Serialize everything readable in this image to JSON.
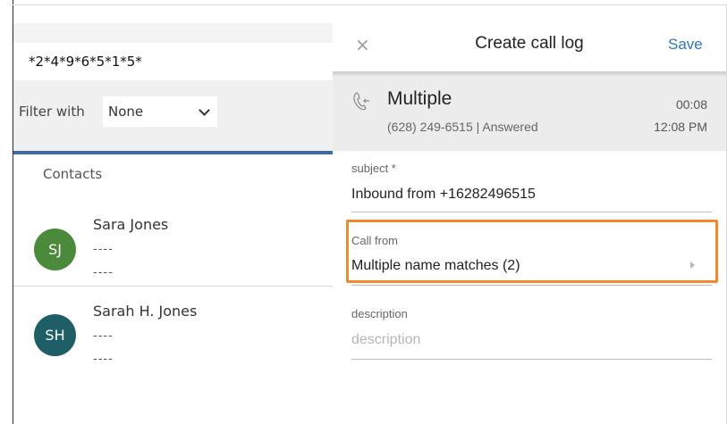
{
  "dialer": {
    "number": "*2*4*9*6*5*1*5*"
  },
  "filter": {
    "label": "Filter with",
    "selected": "None"
  },
  "contacts": {
    "title": "Contacts",
    "items": [
      {
        "initials": "SJ",
        "name": "Sara Jones",
        "line1": "----",
        "line2": "----",
        "avatar_color": "#4b8a3a"
      },
      {
        "initials": "SH",
        "name": "Sarah H. Jones",
        "line1": "----",
        "line2": "----",
        "avatar_color": "#1f5e66"
      }
    ]
  },
  "call_log": {
    "title": "Create call log",
    "save_label": "Save",
    "close_symbol": "×",
    "call": {
      "icon": "incoming-call-icon",
      "name": "Multiple",
      "details": "(628) 249-6515 | Answered",
      "duration": "00:08",
      "time": "12:08 PM"
    },
    "subject": {
      "label": "subject *",
      "value": "Inbound from +16282496515"
    },
    "call_from": {
      "label": "Call from",
      "value": "Multiple name matches (2)"
    },
    "description": {
      "label": "description",
      "placeholder": "description",
      "value": ""
    }
  },
  "colors": {
    "accent_blue": "#2f74c0",
    "filter_underline": "#3e6aa8",
    "highlight_orange": "#f0892f"
  }
}
